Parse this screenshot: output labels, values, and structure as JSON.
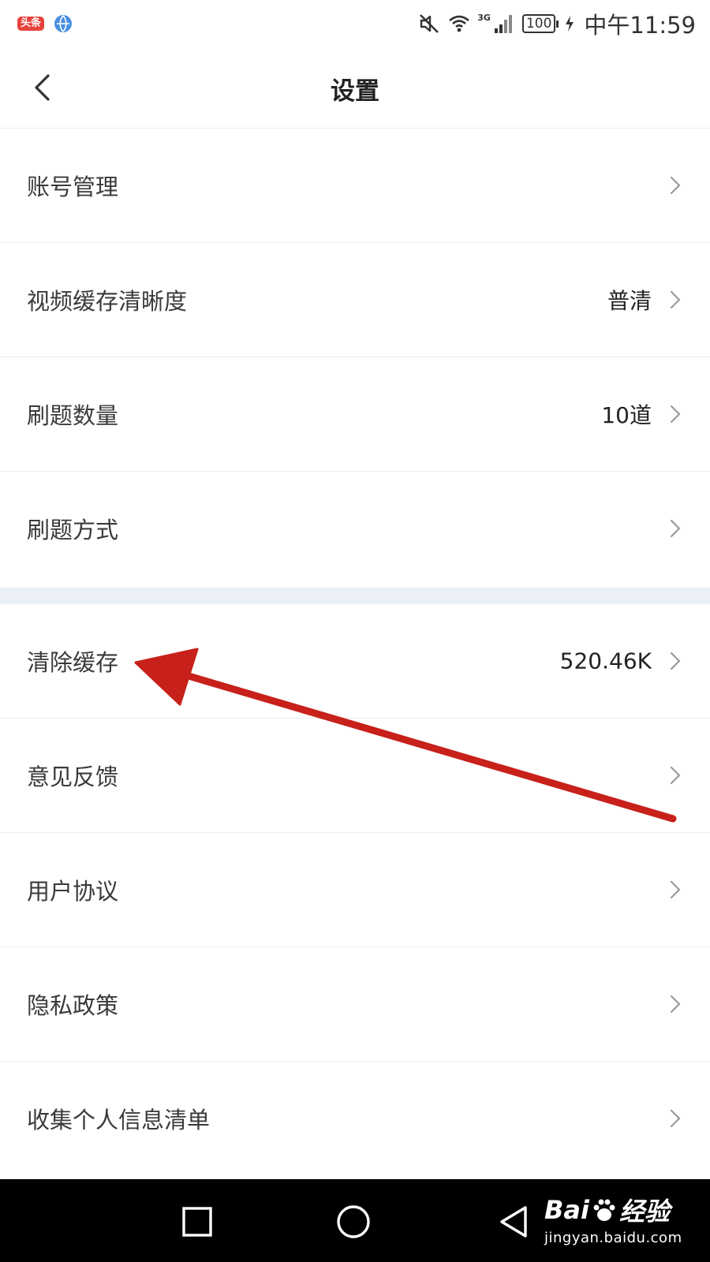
{
  "status_bar": {
    "app_badge": "头条",
    "network": "3G",
    "battery": "100",
    "time": "中午11:59"
  },
  "header": {
    "title": "设置"
  },
  "settings": {
    "group1": [
      {
        "label": "账号管理",
        "value": ""
      },
      {
        "label": "视频缓存清晰度",
        "value": "普清"
      },
      {
        "label": "刷题数量",
        "value": "10道"
      },
      {
        "label": "刷题方式",
        "value": ""
      }
    ],
    "group2": [
      {
        "label": "清除缓存",
        "value": "520.46K"
      },
      {
        "label": "意见反馈",
        "value": ""
      },
      {
        "label": "用户协议",
        "value": ""
      },
      {
        "label": "隐私政策",
        "value": ""
      },
      {
        "label": "收集个人信息清单",
        "value": ""
      }
    ]
  },
  "watermark": {
    "brand_left": "Bai",
    "brand_right": "经验",
    "url": "jingyan.baidu.com"
  },
  "colors": {
    "arrow": "#c8201a",
    "section_gap": "#eaf0f5",
    "nav_background": "#000000"
  },
  "icons": {
    "back": "chevron-left-icon",
    "row_arrow": "chevron-right-icon",
    "status": [
      "mute-icon",
      "wifi-icon",
      "signal-icon",
      "battery-icon",
      "charging-icon"
    ],
    "system_nav": [
      "recent-apps-icon",
      "home-icon",
      "back-triangle-icon"
    ]
  }
}
